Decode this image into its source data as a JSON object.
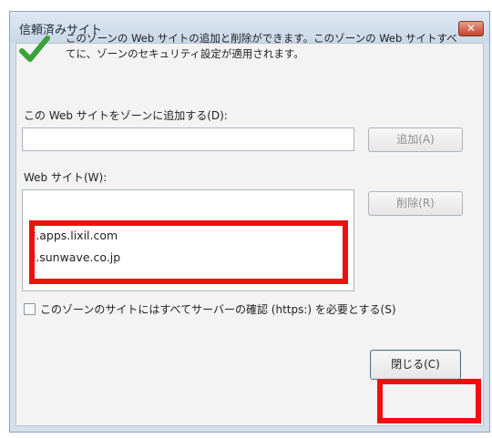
{
  "dialog": {
    "title": "信頼済みサイト",
    "close_glyph": "✕",
    "info_text": "このゾーンの Web サイトの追加と削除ができます。このゾーンの Web サイトすべてに、ゾーンのセキュリティ設定が適用されます。",
    "add_label": "この Web サイトをゾーンに追加する(D):",
    "add_input_value": "",
    "add_button": "追加(A)",
    "sites_label": "Web サイト(W):",
    "sites": [
      "*.apps.lixil.com",
      "*.sunwave.co.jp"
    ],
    "remove_button": "削除(R)",
    "https_checkbox_label": "このゾーンのサイトにはすべてサーバーの確認 (https:) を必要とする(S)",
    "https_checked": false,
    "close_button": "閉じる(C)"
  },
  "colors": {
    "highlight": "#ee1010",
    "check_icon": "#3aa23a",
    "titlebar": "#d5dfeb"
  },
  "icons": {
    "check": "check-icon",
    "close": "close-icon"
  }
}
